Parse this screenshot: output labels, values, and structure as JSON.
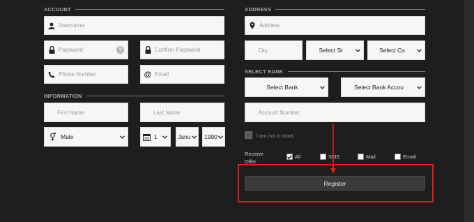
{
  "account": {
    "title": "ACCOUNT",
    "username_placeholder": "Username",
    "password_placeholder": "Password",
    "confirm_password_placeholder": "Confirm Password",
    "phone_placeholder": "Phone Number",
    "email_placeholder": "Email",
    "help_glyph": "?"
  },
  "information": {
    "title": "INFORMATION",
    "first_name_placeholder": "First Name",
    "last_name_placeholder": "Last Name",
    "gender_value": "Male",
    "day_value": "1",
    "month_value": "Janu",
    "year_value": "1990"
  },
  "address": {
    "title": "ADDRESS",
    "address_placeholder": "Address",
    "city_placeholder": "City",
    "state_select": "Select St",
    "country_select": "Select Co"
  },
  "bank": {
    "title": "SELECT BANK",
    "bank_select": "Select Bank",
    "account_select": "Select Bank Accou",
    "account_number_placeholder": "Account Number"
  },
  "captcha": {
    "label": "I am not a robot"
  },
  "receive_offer": {
    "label": "Receive Offer",
    "options": [
      {
        "label": "All",
        "checked": true
      },
      {
        "label": "SMS",
        "checked": false
      },
      {
        "label": "Mail",
        "checked": false
      },
      {
        "label": "Email",
        "checked": false
      }
    ]
  },
  "register": {
    "label": "Register"
  },
  "colors": {
    "background": "#1e1e1e",
    "highlight": "#d92020",
    "button": "#3b3b3b"
  }
}
